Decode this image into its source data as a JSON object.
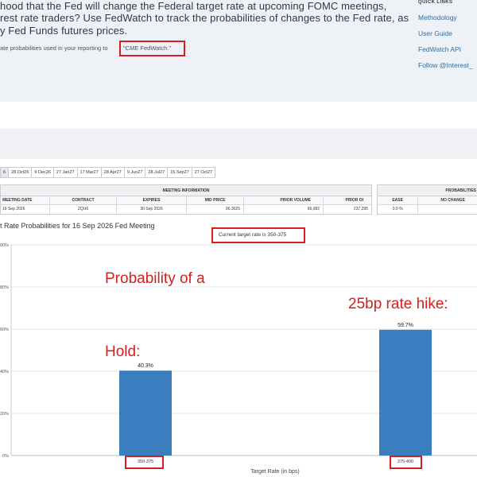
{
  "intro": {
    "line1": "hood that the Fed will change the Federal target rate at upcoming FOMC meetings,",
    "line2": "rest rate traders? Use FedWatch to track the probabilities of changes to the Fed rate, as",
    "line3": "y Fed Funds futures prices.",
    "attribution_prefix": "ate probabilities used in your reporting to",
    "citation": "\"CME FedWatch.\""
  },
  "quick_links": {
    "header": "QUICK LINKS",
    "items": [
      "Methodology",
      "User Guide",
      "FedWatch API",
      "Follow @Interest_"
    ]
  },
  "meeting_tabs": [
    "6",
    "28 Oct26",
    "9 Dec26",
    "27 Jan27",
    "17 Mar27",
    "28 Apr27",
    "9 Jun27",
    "28 Jul27",
    "15 Sep27",
    "27 Oct27"
  ],
  "meeting_info": {
    "section_title": "MEETING INFORMATION",
    "columns": [
      "MEETING DATE",
      "CONTRACT",
      "EXPIRES",
      "MID PRICE",
      "PRIOR VOLUME",
      "PRIOR OI"
    ],
    "row": [
      "16 Sep 2026",
      "ZQU6",
      "30 Sep 2026",
      "96.3025",
      "66,082",
      "237,295"
    ]
  },
  "probabilities_table": {
    "section_title": "PROBABILITIES",
    "columns": [
      "EASE",
      "NO CHANGE"
    ],
    "row": [
      "0.0 %",
      ""
    ]
  },
  "chart_header": {
    "title": "t Rate Probabilities for 16 Sep 2026 Fed Meeting",
    "current_target": "Current target rate is 350-375"
  },
  "annotations": {
    "hold_line1": "Probability of a",
    "hold_line2": "Hold:",
    "hike": "25bp rate hike:"
  },
  "chart_data": {
    "type": "bar",
    "title": "t Rate Probabilities for 16 Sep 2026 Fed Meeting",
    "categories": [
      "350-375",
      "375-400"
    ],
    "values": [
      40.3,
      59.7
    ],
    "value_labels": [
      "40.3%",
      "59.7%"
    ],
    "xlabel": "Target Rate (in bps)",
    "ylabel": "",
    "ylim": [
      0,
      100
    ],
    "yticks": [
      "0%",
      "20%",
      "40%",
      "60%",
      "80%",
      "100%"
    ],
    "bar_color": "#3a7ebf",
    "grid": true,
    "legend": "none"
  },
  "colors": {
    "annotation_red": "#d21f1f",
    "link_blue": "#2c6ea6",
    "intro_bg": "#eef1f5"
  }
}
